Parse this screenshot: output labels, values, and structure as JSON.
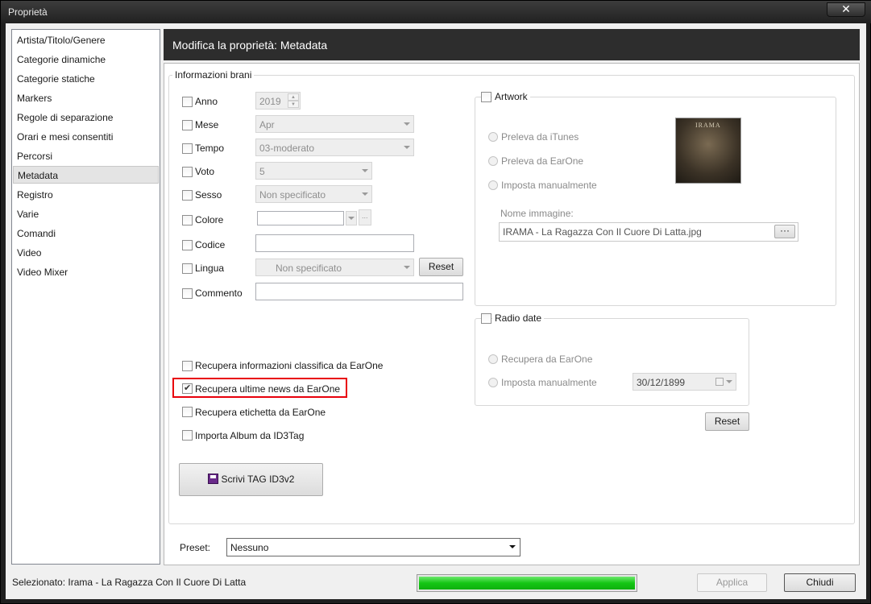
{
  "window": {
    "title": "Proprietà",
    "close_icon": "close-icon"
  },
  "sidebar": {
    "items": [
      {
        "label": "Artista/Titolo/Genere"
      },
      {
        "label": "Categorie dinamiche"
      },
      {
        "label": "Categorie statiche"
      },
      {
        "label": "Markers"
      },
      {
        "label": "Regole di separazione"
      },
      {
        "label": "Orari e mesi consentiti"
      },
      {
        "label": "Percorsi"
      },
      {
        "label": "Metadata",
        "selected": true
      },
      {
        "label": "Registro"
      },
      {
        "label": "Varie"
      },
      {
        "label": "Comandi"
      },
      {
        "label": "Video"
      },
      {
        "label": "Video Mixer"
      }
    ]
  },
  "header": {
    "title": "Modifica la proprietà: Metadata"
  },
  "info": {
    "group_label": "Informazioni brani",
    "anno": {
      "label": "Anno",
      "value": "2019"
    },
    "mese": {
      "label": "Mese",
      "value": "Apr"
    },
    "tempo": {
      "label": "Tempo",
      "value": "03-moderato"
    },
    "voto": {
      "label": "Voto",
      "value": "5"
    },
    "sesso": {
      "label": "Sesso",
      "value": "Non specificato"
    },
    "colore": {
      "label": "Colore",
      "value": "",
      "more_label": "..."
    },
    "codice": {
      "label": "Codice",
      "value": ""
    },
    "lingua": {
      "label": "Lingua",
      "value": "Non specificato",
      "reset_label": "Reset"
    },
    "commento": {
      "label": "Commento",
      "value": ""
    }
  },
  "options": [
    {
      "label": "Recupera informazioni classifica da EarOne",
      "checked": false
    },
    {
      "label": "Recupera ultime news da EarOne",
      "checked": true
    },
    {
      "label": "Recupera etichetta da EarOne",
      "checked": false
    },
    {
      "label": "Importa Album da ID3Tag",
      "checked": false
    }
  ],
  "write_tag": {
    "label": "Scrivi TAG ID3v2",
    "icon": "save-icon"
  },
  "artwork": {
    "label": "Artwork",
    "radio_itunes": "Preleva da iTunes",
    "radio_earone": "Preleva da EarOne",
    "radio_manual": "Imposta manualmente",
    "image_name_label": "Nome immagine:",
    "image_name_value": "IRAMA - La Ragazza Con  Il Cuore Di Latta.jpg",
    "browse_label": "···",
    "cover_text": "IRAMA"
  },
  "radio_date": {
    "label": "Radio date",
    "radio_earone": "Recupera da EarOne",
    "radio_manual": "Imposta manualmente",
    "date_value": "30/12/1899",
    "reset_label": "Reset"
  },
  "preset": {
    "label": "Preset:",
    "value": "Nessuno"
  },
  "status": {
    "selected_text": "Selezionato: Irama - La Ragazza Con  Il Cuore Di Latta",
    "progress": 1.0
  },
  "buttons": {
    "apply": "Applica",
    "close": "Chiudi"
  }
}
